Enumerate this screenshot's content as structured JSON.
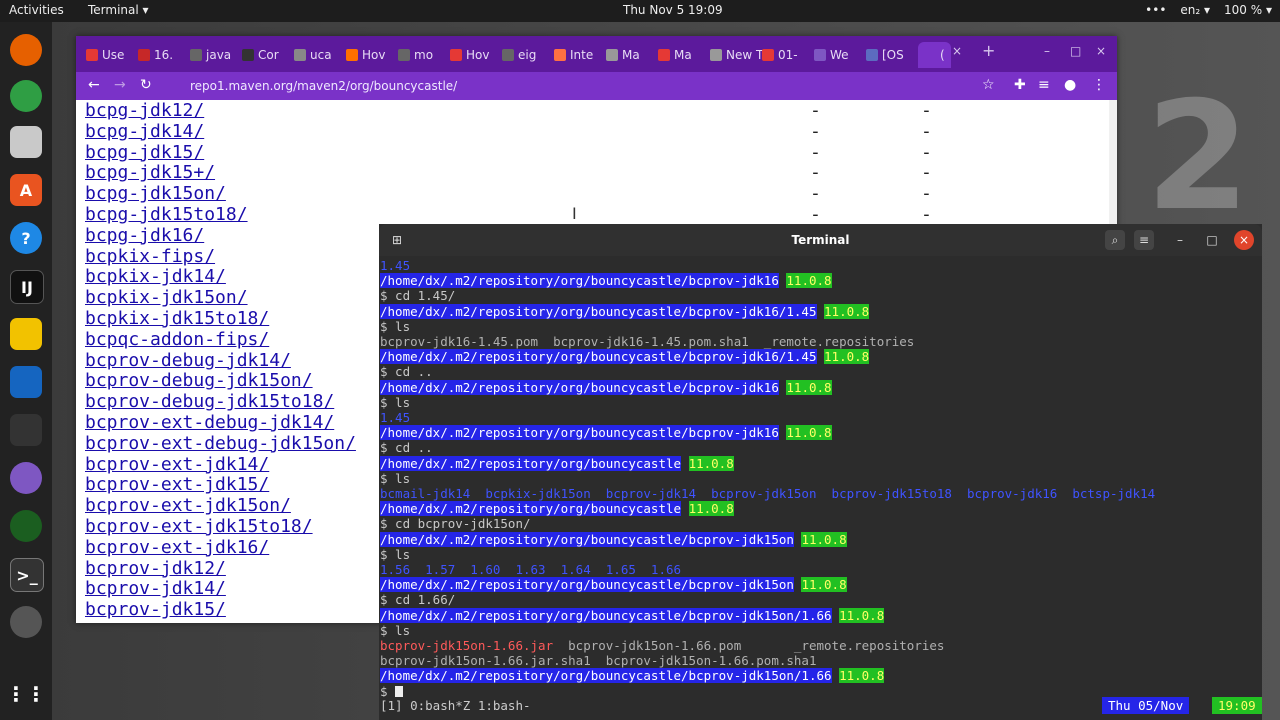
{
  "topbar": {
    "activities": "Activities",
    "app": "Terminal ▾",
    "clock": "Thu Nov 5  19:09",
    "lang": "en₂ ▾",
    "battery": "100 % ▾"
  },
  "browser": {
    "tabs": [
      "Use",
      "16.",
      "java",
      "Cor",
      "uca",
      "Hov",
      "mo",
      "Hov",
      "eig",
      "Inte",
      "Ma",
      "Ma",
      "New Ta",
      "01-",
      "We",
      "[OS",
      "("
    ],
    "url": "repo1.maven.org/maven2/org/bouncycastle/",
    "listing": [
      "bcpg-jdk12/",
      "bcpg-jdk14/",
      "bcpg-jdk15/",
      "bcpg-jdk15+/",
      "bcpg-jdk15on/",
      "bcpg-jdk15to18/",
      "bcpg-jdk16/",
      "bcpkix-fips/",
      "bcpkix-jdk14/",
      "bcpkix-jdk15on/",
      "bcpkix-jdk15to18/",
      "bcpqc-addon-fips/",
      "bcprov-debug-jdk14/",
      "bcprov-debug-jdk15on/",
      "bcprov-debug-jdk15to18/",
      "bcprov-ext-debug-jdk14/",
      "bcprov-ext-debug-jdk15on/",
      "bcprov-ext-jdk14/",
      "bcprov-ext-jdk15/",
      "bcprov-ext-jdk15on/",
      "bcprov-ext-jdk15to18/",
      "bcprov-ext-jdk16/",
      "bcprov-jdk12/",
      "bcprov-jdk14/",
      "bcprov-jdk15/"
    ],
    "dash": "-"
  },
  "terminal": {
    "title": "Terminal",
    "lines": [
      {
        "t": "dirs",
        "a": "1.45"
      },
      {
        "t": "prompt",
        "p": "/home/dx/.m2/repository/org/bouncycastle/bcprov-jdk16",
        "v": "11.0.8"
      },
      {
        "t": "cmd",
        "a": "$ cd 1.45/"
      },
      {
        "t": "prompt",
        "p": "/home/dx/.m2/repository/org/bouncycastle/bcprov-jdk16/1.45",
        "v": "11.0.8"
      },
      {
        "t": "cmd",
        "a": "$ ls"
      },
      {
        "t": "out",
        "a": "bcprov-jdk16-1.45.pom  bcprov-jdk16-1.45.pom.sha1  _remote.repositories"
      },
      {
        "t": "prompt",
        "p": "/home/dx/.m2/repository/org/bouncycastle/bcprov-jdk16/1.45",
        "v": "11.0.8"
      },
      {
        "t": "cmd",
        "a": "$ cd .."
      },
      {
        "t": "prompt",
        "p": "/home/dx/.m2/repository/org/bouncycastle/bcprov-jdk16",
        "v": "11.0.8"
      },
      {
        "t": "cmd",
        "a": "$ ls"
      },
      {
        "t": "dirs",
        "a": "1.45"
      },
      {
        "t": "prompt",
        "p": "/home/dx/.m2/repository/org/bouncycastle/bcprov-jdk16",
        "v": "11.0.8"
      },
      {
        "t": "cmd",
        "a": "$ cd .."
      },
      {
        "t": "prompt",
        "p": "/home/dx/.m2/repository/org/bouncycastle",
        "v": "11.0.8"
      },
      {
        "t": "cmd",
        "a": "$ ls"
      },
      {
        "t": "dirs",
        "a": "bcmail-jdk14  bcpkix-jdk15on  bcprov-jdk14  bcprov-jdk15on  bcprov-jdk15to18  bcprov-jdk16  bctsp-jdk14"
      },
      {
        "t": "prompt",
        "p": "/home/dx/.m2/repository/org/bouncycastle",
        "v": "11.0.8"
      },
      {
        "t": "cmd",
        "a": "$ cd bcprov-jdk15on/"
      },
      {
        "t": "prompt",
        "p": "/home/dx/.m2/repository/org/bouncycastle/bcprov-jdk15on",
        "v": "11.0.8"
      },
      {
        "t": "cmd",
        "a": "$ ls"
      },
      {
        "t": "dirs",
        "a": "1.56  1.57  1.60  1.63  1.64  1.65  1.66"
      },
      {
        "t": "prompt",
        "p": "/home/dx/.m2/repository/org/bouncycastle/bcprov-jdk15on",
        "v": "11.0.8"
      },
      {
        "t": "cmd",
        "a": "$ cd 1.66/"
      },
      {
        "t": "prompt",
        "p": "/home/dx/.m2/repository/org/bouncycastle/bcprov-jdk15on/1.66",
        "v": "11.0.8"
      },
      {
        "t": "cmd",
        "a": "$ ls"
      },
      {
        "t": "ls1",
        "a": "bcprov-jdk15on-1.66.jar",
        "b": "  bcprov-jdk15on-1.66.pom       _remote.repositories"
      },
      {
        "t": "out",
        "a": "bcprov-jdk15on-1.66.jar.sha1  bcprov-jdk15on-1.66.pom.sha1"
      },
      {
        "t": "prompt",
        "p": "/home/dx/.m2/repository/org/bouncycastle/bcprov-jdk15on/1.66",
        "v": "11.0.8"
      },
      {
        "t": "cur",
        "a": "$ "
      }
    ],
    "status_left": "[1] 0:bash*Z 1:bash-",
    "status_date": "Thu 05/Nov",
    "status_time": "19:09"
  }
}
